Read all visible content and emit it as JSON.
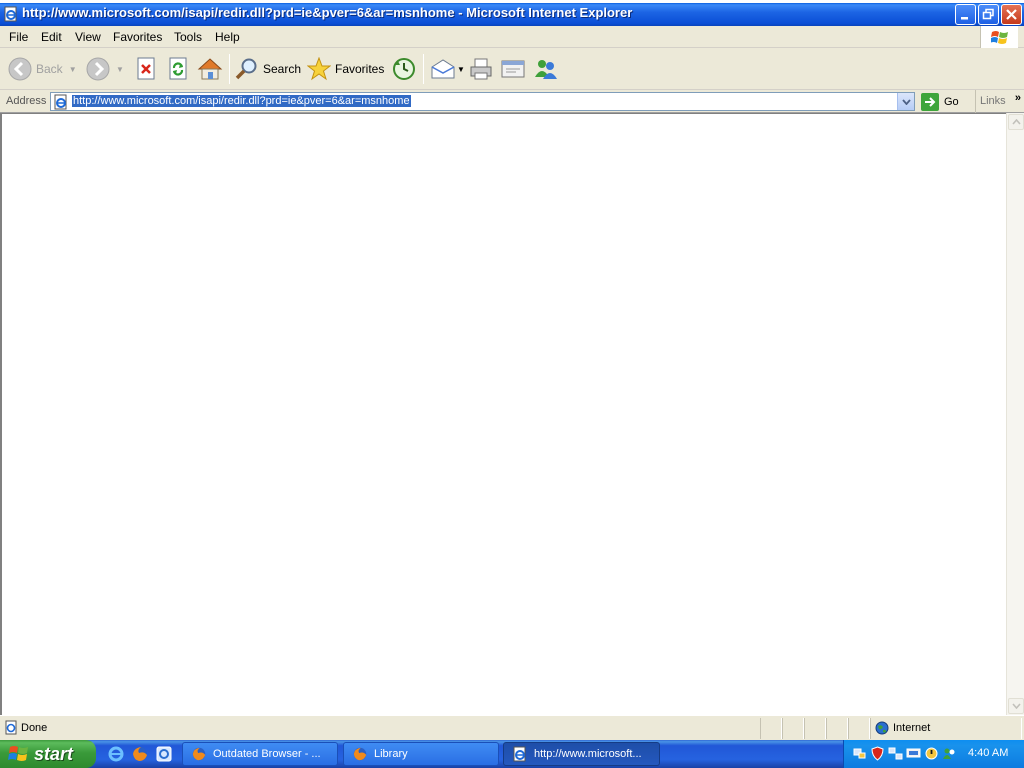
{
  "window": {
    "title": "http://www.microsoft.com/isapi/redir.dll?prd=ie&pver=6&ar=msnhome - Microsoft Internet Explorer"
  },
  "menu": [
    "File",
    "Edit",
    "View",
    "Favorites",
    "Tools",
    "Help"
  ],
  "toolbar": {
    "back_label": "Back",
    "search_label": "Search",
    "favorites_label": "Favorites"
  },
  "address": {
    "label": "Address",
    "url": "http://www.microsoft.com/isapi/redir.dll?prd=ie&pver=6&ar=msnhome",
    "go_label": "Go",
    "links_label": "Links"
  },
  "status": {
    "text": "Done",
    "zone": "Internet"
  },
  "taskbar": {
    "start_label": "start",
    "tasks": [
      {
        "label": "Outdated Browser - ...",
        "icon": "firefox-icon"
      },
      {
        "label": "Library",
        "icon": "firefox-icon"
      },
      {
        "label": "http://www.microsoft...",
        "icon": "ie-icon"
      }
    ],
    "clock": "4:40 AM"
  },
  "colors": {
    "title_blue": "#0b4fd6",
    "selection": "#316ac5",
    "start_green": "#3a9a3a",
    "taskbar_blue": "#2663e0"
  }
}
